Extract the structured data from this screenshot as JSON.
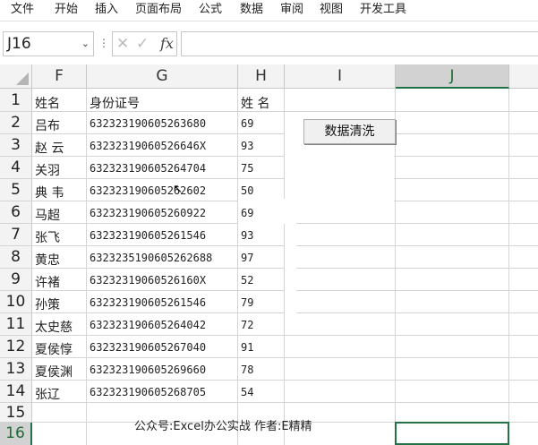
{
  "ribbon": {
    "tabs": [
      "文件",
      "开始",
      "插入",
      "页面布局",
      "公式",
      "数据",
      "审阅",
      "视图",
      "开发工具"
    ]
  },
  "formula_bar": {
    "name_box": "J16",
    "formula": ""
  },
  "columns": [
    "F",
    "G",
    "H",
    "I",
    "J"
  ],
  "selected_column": "J",
  "row_numbers": [
    "1",
    "2",
    "3",
    "4",
    "5",
    "6",
    "7",
    "8",
    "9",
    "10",
    "11",
    "12",
    "13",
    "14",
    "15",
    "16"
  ],
  "selected_row": "16",
  "table": {
    "headers": [
      "姓名",
      "身份证号",
      "姓 名"
    ],
    "rows": [
      {
        "name": "吕布",
        "id": "632323190605263680",
        "score": "69"
      },
      {
        "name": "赵 云",
        "id": "63232319060526646X",
        "score": "93"
      },
      {
        "name": "关羽",
        "id": "632323190605264704",
        "score": "75"
      },
      {
        "name": "典 韦",
        "id": "632323190605262602",
        "score": "50"
      },
      {
        "name": "马超",
        "id": "632323190605260922",
        "score": "69"
      },
      {
        "name": "张飞",
        "id": "632323190605261546",
        "score": "93"
      },
      {
        "name": "黄忠",
        "id": "632323519060526268​8",
        "score": "97"
      },
      {
        "name": "许褚",
        "id": "63232319060526160X",
        "score": "52"
      },
      {
        "name": "孙策",
        "id": "632323190605261546",
        "score": "79"
      },
      {
        "name": "太史慈",
        "id": "632323190605264042",
        "score": "72"
      },
      {
        "name": "夏侯惇",
        "id": "632323190605267040",
        "score": "91"
      },
      {
        "name": "夏侯渊",
        "id": "632323190605269660",
        "score": "78"
      },
      {
        "name": "张辽",
        "id": "632323190605268705",
        "score": "54"
      }
    ]
  },
  "button": {
    "label": "数据清洗"
  },
  "footer": "公众号:Excel办公实战  作者:E精精",
  "icons": [
    "name-box-chevron-down-icon",
    "cancel-x-icon",
    "confirm-check-icon",
    "fx-function-icon",
    "select-all-corner-icon",
    "mouse-cursor-icon"
  ],
  "colors": {
    "accent": "#217346",
    "header_bg": "#f3f3f3",
    "selected_header_bg": "#d2d2d2",
    "gridline": "#d4d4d4"
  }
}
